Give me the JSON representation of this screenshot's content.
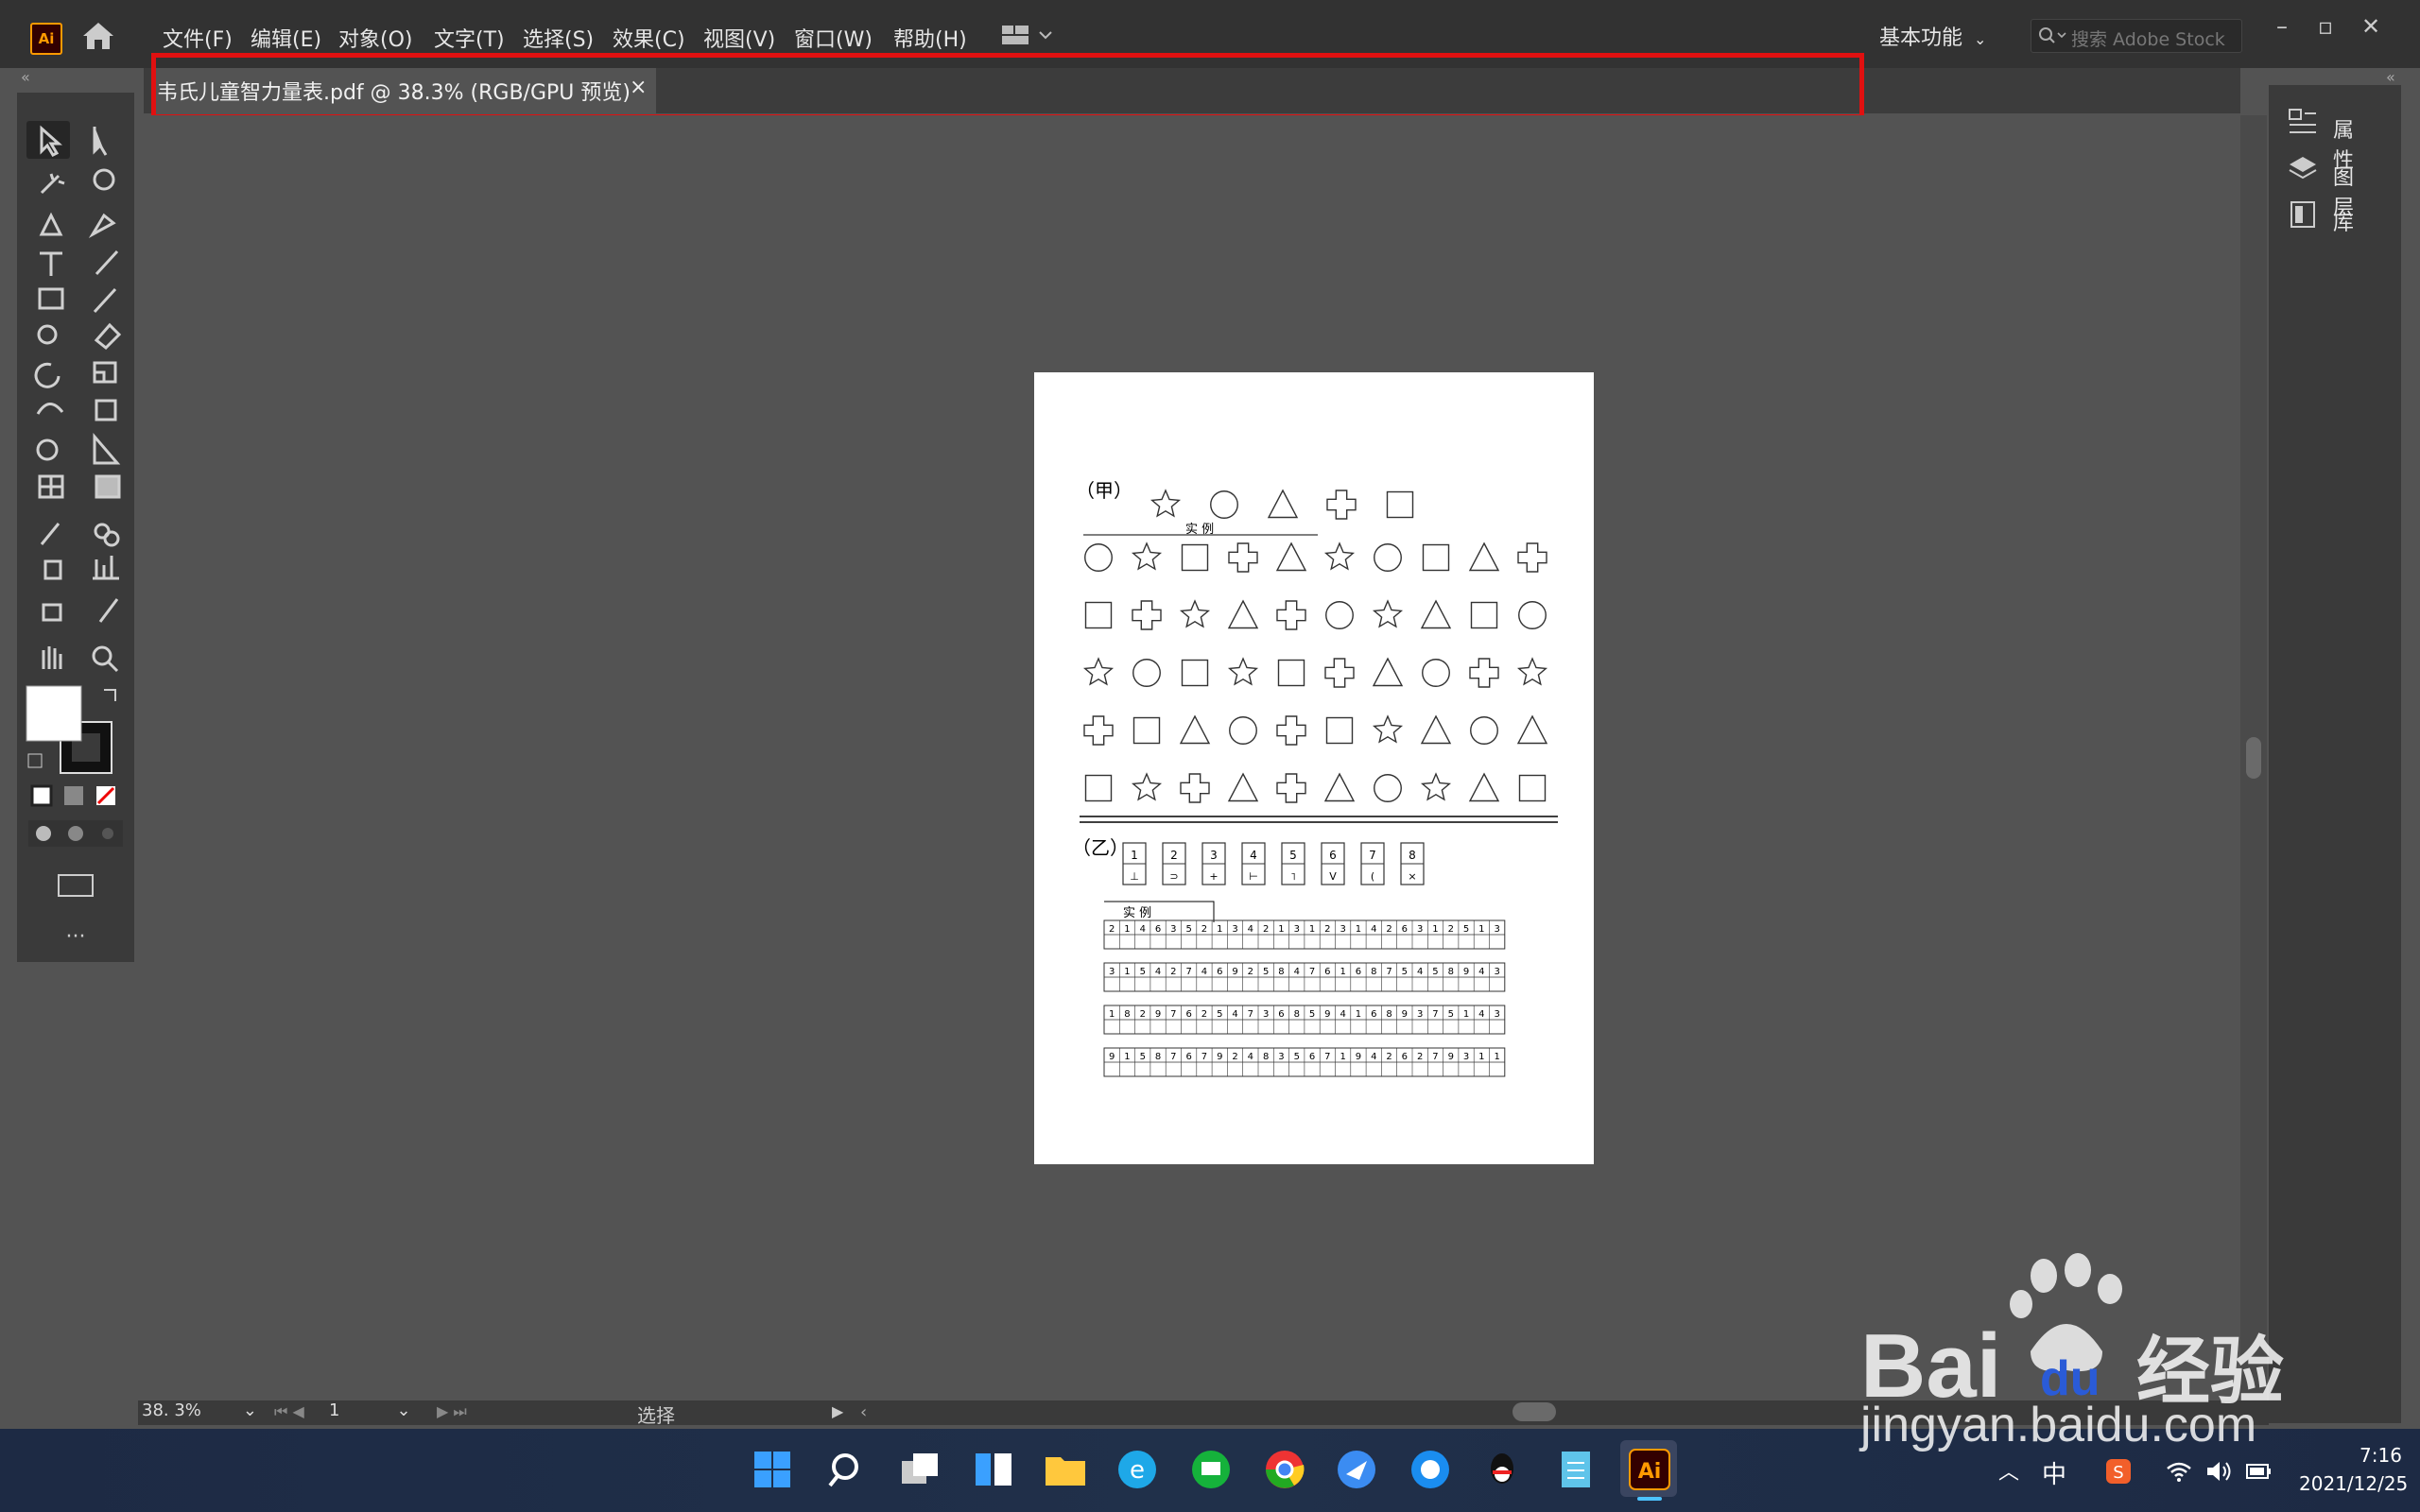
{
  "app": {
    "logo_text": "Ai"
  },
  "menu": [
    "文件(F)",
    "编辑(E)",
    "对象(O)",
    "文字(T)",
    "选择(S)",
    "效果(C)",
    "视图(V)",
    "窗口(W)",
    "帮助(H)"
  ],
  "workspace": {
    "label": "基本功能"
  },
  "stock_search": {
    "placeholder": "搜索 Adobe Stock"
  },
  "document_tab": {
    "title": "韦氏儿童智力量表.pdf @ 38.3% (RGB/GPU 预览)",
    "close_glyph": "×"
  },
  "right_panel": {
    "items": [
      "属性",
      "图层",
      "库"
    ]
  },
  "artboard": {
    "section_a_label": "（甲）",
    "section_a_example_label": "实    例",
    "example_shapes": [
      "star",
      "circle",
      "triangle",
      "cross",
      "square"
    ],
    "symbol_grid": [
      [
        "circle",
        "star",
        "square",
        "cross",
        "triangle",
        "star",
        "circle",
        "square",
        "triangle",
        "cross"
      ],
      [
        "square",
        "cross",
        "star",
        "triangle",
        "cross",
        "circle",
        "star",
        "triangle",
        "square",
        "circle"
      ],
      [
        "star",
        "circle",
        "square",
        "star",
        "square",
        "cross",
        "triangle",
        "circle",
        "cross",
        "star"
      ],
      [
        "cross",
        "square",
        "triangle",
        "circle",
        "cross",
        "square",
        "star",
        "triangle",
        "circle",
        "triangle"
      ],
      [
        "square",
        "star",
        "cross",
        "triangle",
        "cross",
        "triangle",
        "circle",
        "star",
        "triangle",
        "square"
      ]
    ],
    "section_b_label": "（乙）",
    "section_b_keys": [
      "1",
      "2",
      "3",
      "4",
      "5",
      "6",
      "7",
      "8"
    ],
    "section_b_key_symbols": [
      "⊥",
      "⊃",
      "+",
      "⊢",
      "˥",
      "V",
      "(",
      "×"
    ],
    "section_b_example_label": "实    例",
    "digit_rows": [
      "21463521342131231426312513",
      "31542746925847616875458943",
      "18297625473685941689375143",
      "91587679248356719426279311"
    ]
  },
  "status": {
    "zoom": "38. 3%",
    "page": "1",
    "tool": "选择"
  },
  "taskbar": {
    "ime": "中",
    "time": "7:16",
    "date": "2021/12/25"
  },
  "watermark": {
    "brand": "Bai",
    "brand2": "du",
    "cn": "经验",
    "url": "jingyan.baidu.com"
  }
}
